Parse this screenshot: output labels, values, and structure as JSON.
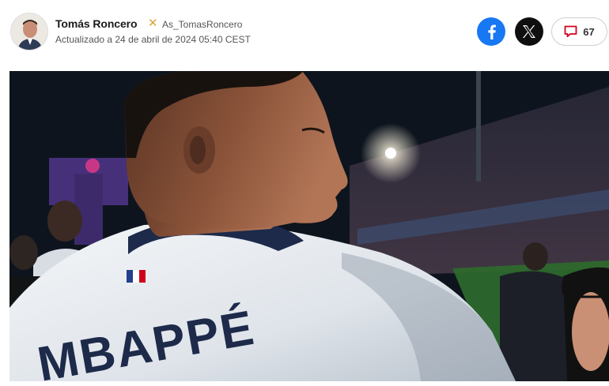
{
  "author": {
    "name": "Tomás Roncero",
    "handle": "As_TomasRoncero",
    "updated": "Actualizado a 24 de abril de 2024 05:40 CEST",
    "avatar_icon": "author-avatar"
  },
  "share": {
    "facebook_icon": "facebook-icon",
    "x_icon": "x-twitter-icon",
    "comments_icon": "comment-bubble-icon",
    "comments_count": "67"
  },
  "photo": {
    "jersey_text": "MBAPPÉ",
    "description_icon": "article-photo"
  },
  "colors": {
    "facebook": "#1877f2",
    "x": "#0f0f0f",
    "comment_accent": "#d0021b",
    "handle_badge": "#d8a53a"
  }
}
